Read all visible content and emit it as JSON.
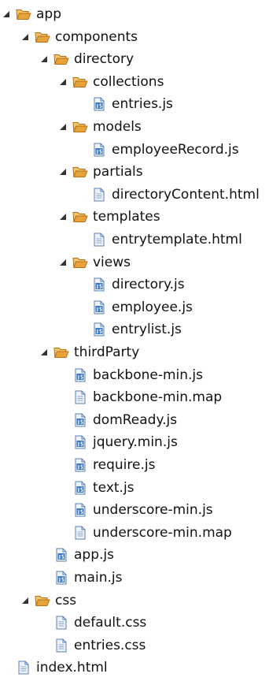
{
  "tree": {
    "items": [
      {
        "label": "app",
        "depth": 0,
        "type": "folder",
        "expanded": true
      },
      {
        "label": "components",
        "depth": 1,
        "type": "folder",
        "expanded": true
      },
      {
        "label": "directory",
        "depth": 2,
        "type": "folder",
        "expanded": true
      },
      {
        "label": "collections",
        "depth": 3,
        "type": "folder",
        "expanded": true
      },
      {
        "label": "entries.js",
        "depth": 4,
        "type": "js-file"
      },
      {
        "label": "models",
        "depth": 3,
        "type": "folder",
        "expanded": true
      },
      {
        "label": "employeeRecord.js",
        "depth": 4,
        "type": "js-file"
      },
      {
        "label": "partials",
        "depth": 3,
        "type": "folder",
        "expanded": true
      },
      {
        "label": "directoryContent.html",
        "depth": 4,
        "type": "text-file"
      },
      {
        "label": "templates",
        "depth": 3,
        "type": "folder",
        "expanded": true
      },
      {
        "label": "entrytemplate.html",
        "depth": 4,
        "type": "text-file"
      },
      {
        "label": "views",
        "depth": 3,
        "type": "folder",
        "expanded": true
      },
      {
        "label": "directory.js",
        "depth": 4,
        "type": "js-file"
      },
      {
        "label": "employee.js",
        "depth": 4,
        "type": "js-file"
      },
      {
        "label": "entrylist.js",
        "depth": 4,
        "type": "js-file"
      },
      {
        "label": "thirdParty",
        "depth": 2,
        "type": "folder",
        "expanded": true
      },
      {
        "label": "backbone-min.js",
        "depth": 3,
        "type": "js-file"
      },
      {
        "label": "backbone-min.map",
        "depth": 3,
        "type": "text-file"
      },
      {
        "label": "domReady.js",
        "depth": 3,
        "type": "js-file"
      },
      {
        "label": "jquery.min.js",
        "depth": 3,
        "type": "js-file"
      },
      {
        "label": "require.js",
        "depth": 3,
        "type": "js-file"
      },
      {
        "label": "text.js",
        "depth": 3,
        "type": "js-file"
      },
      {
        "label": "underscore-min.js",
        "depth": 3,
        "type": "js-file"
      },
      {
        "label": "underscore-min.map",
        "depth": 3,
        "type": "text-file"
      },
      {
        "label": "app.js",
        "depth": 2,
        "type": "js-file"
      },
      {
        "label": "main.js",
        "depth": 2,
        "type": "js-file"
      },
      {
        "label": "css",
        "depth": 1,
        "type": "folder",
        "expanded": true
      },
      {
        "label": "default.css",
        "depth": 2,
        "type": "text-file"
      },
      {
        "label": "entries.css",
        "depth": 2,
        "type": "text-file"
      },
      {
        "label": "index.html",
        "depth": 0,
        "type": "text-file"
      }
    ]
  },
  "colors": {
    "folder": "#e8a23a",
    "folder_stroke": "#b86f12",
    "twisty": "#333333",
    "file_page": "#eef3fb",
    "file_stroke": "#5a7fb3",
    "js_badge": "#3a78c2",
    "text_lines": "#90a4c4"
  },
  "icons": {
    "folder": "folder-open-icon",
    "js-file": "js-file-icon",
    "text-file": "text-file-icon",
    "twisty": "expand-triangle-icon"
  }
}
